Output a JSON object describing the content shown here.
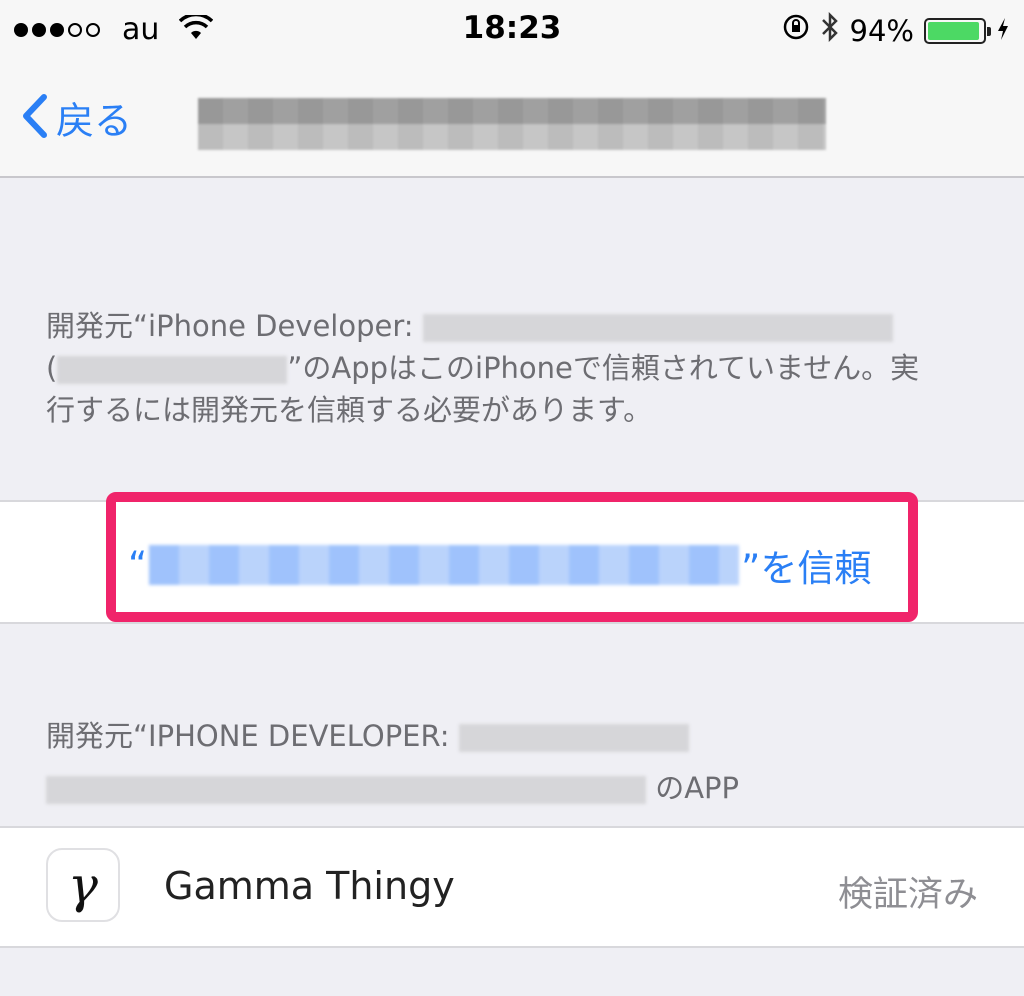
{
  "status_bar": {
    "carrier": "au",
    "time": "18:23",
    "battery_percent": "94%",
    "battery_level": 0.94
  },
  "nav": {
    "back_label": "戻る"
  },
  "trust_section": {
    "description_prefix": "開発元“iPhone Developer:",
    "description_open_paren": "(",
    "description_suffix": "”のAppはこのiPhoneで信頼されていません。実行するには開発元を信頼する必要があります。",
    "trust_button_open_quote": "“",
    "trust_button_suffix": "”を信頼"
  },
  "apps_section": {
    "header_prefix": "開発元“IPHONE DEVELOPER:",
    "header_suffix": "のAPP",
    "apps": [
      {
        "icon_glyph": "γ",
        "name": "Gamma Thingy",
        "status": "検証済み"
      }
    ]
  },
  "colors": {
    "accent_blue": "#2a7ff5",
    "highlight_pink": "#f0246a",
    "battery_green": "#4cd964",
    "background": "#efeff4"
  }
}
